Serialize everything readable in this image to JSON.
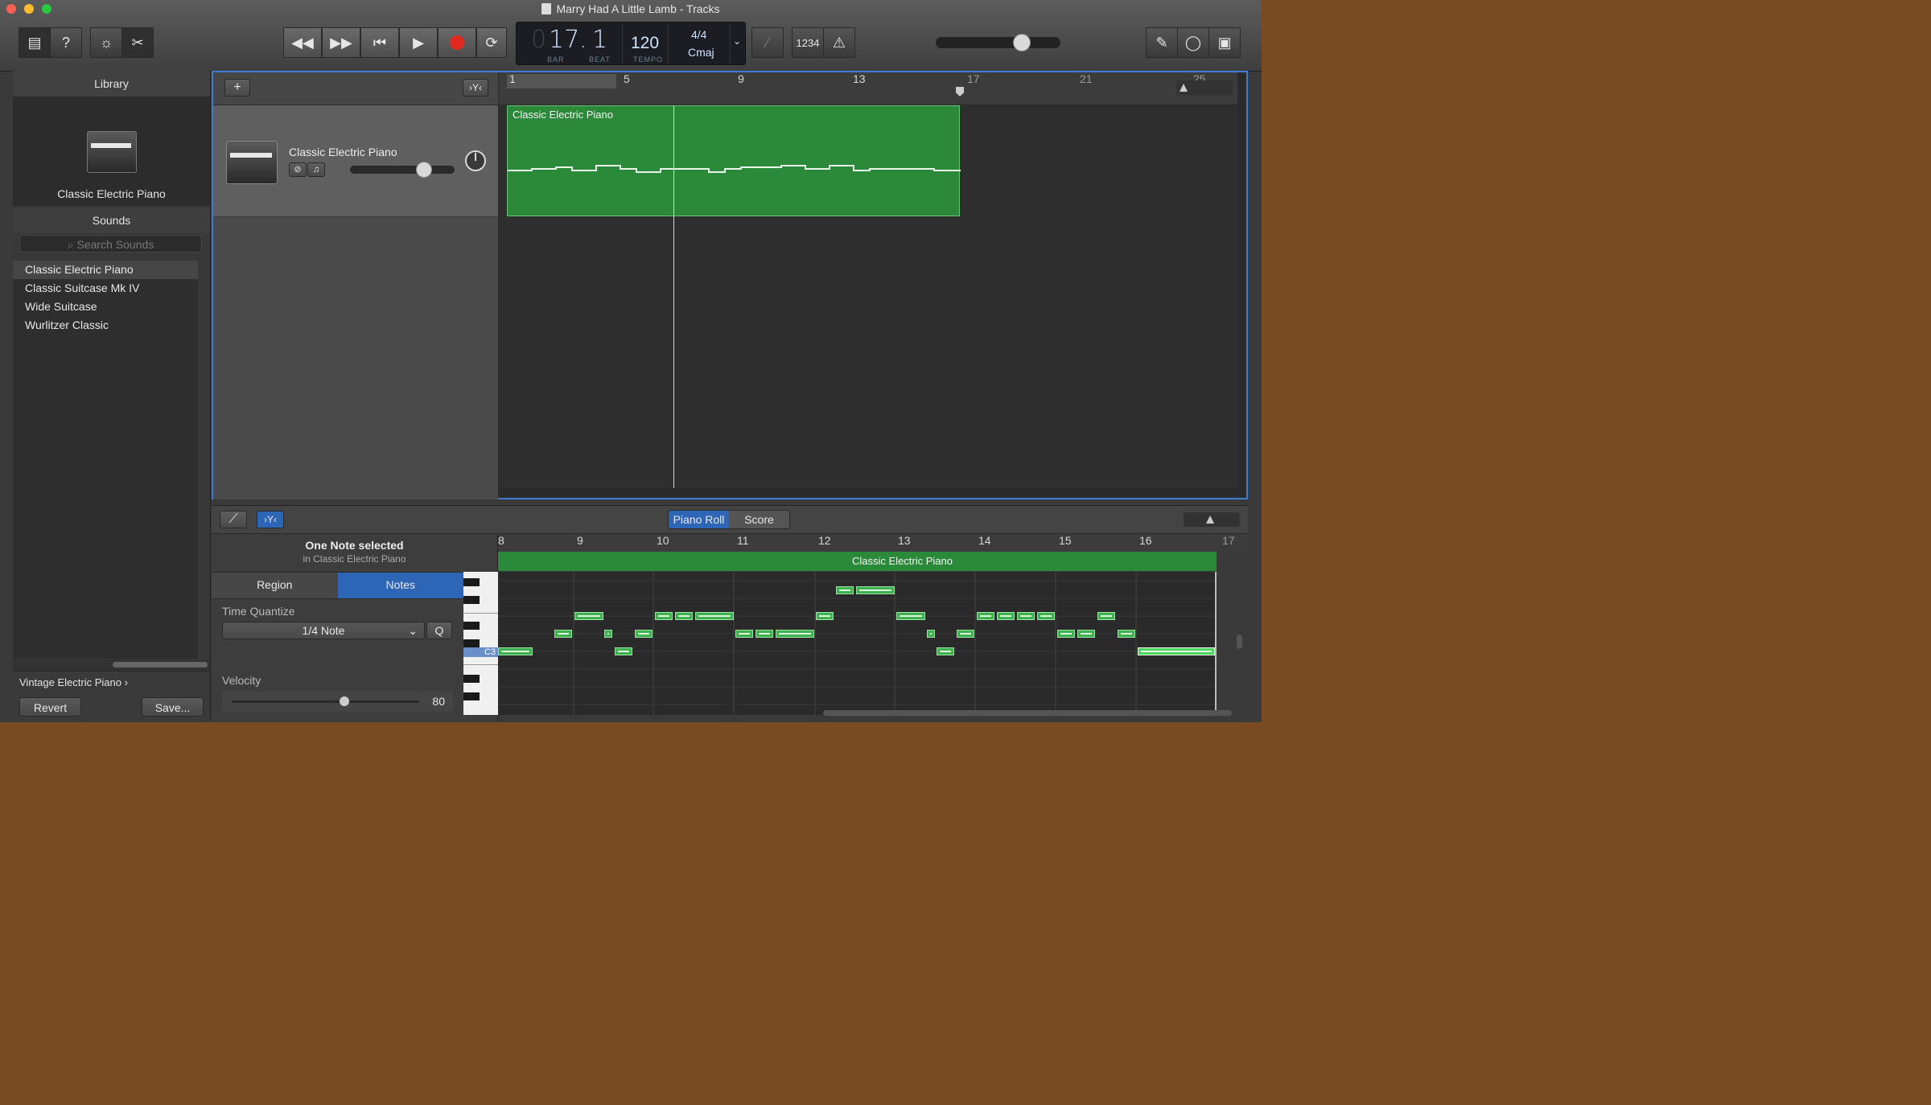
{
  "window": {
    "title": "Marry Had A Little Lamb - Tracks"
  },
  "toolbar": {
    "lcd": {
      "bar_lead": "0",
      "bar": "17",
      "beat": "1",
      "bar_label": "BAR",
      "beat_label": "BEAT",
      "tempo": "120",
      "tempo_label": "TEMPO",
      "signature": "4/4",
      "key": "Cmaj"
    },
    "count_in": "1234"
  },
  "library": {
    "header": "Library",
    "current_patch": "Classic Electric Piano",
    "sounds_header": "Sounds",
    "search_placeholder": "Search Sounds",
    "sounds": [
      "Classic Electric Piano",
      "Classic Suitcase Mk IV",
      "Wide Suitcase",
      "Wurlitzer Classic"
    ],
    "breadcrumb": "Vintage Electric Piano",
    "revert": "Revert",
    "save": "Save..."
  },
  "tracks": {
    "track_name": "Classic Electric Piano",
    "region_name": "Classic Electric Piano",
    "ruler": [
      "1",
      "5",
      "9",
      "13",
      "17",
      "21",
      "25"
    ]
  },
  "editor": {
    "tab_piano_roll": "Piano Roll",
    "tab_score": "Score",
    "selection_title": "One Note selected",
    "selection_sub": "in Classic Electric Piano",
    "tab_region": "Region",
    "tab_notes": "Notes",
    "time_quantize_label": "Time Quantize",
    "time_quantize_value": "1/4 Note",
    "quantize_button": "Q",
    "velocity_label": "Velocity",
    "velocity_value": "80",
    "velocity_fraction": 0.6,
    "key_label": "C3",
    "ruler": [
      "8",
      "9",
      "10",
      "11",
      "12",
      "13",
      "14",
      "15",
      "16",
      "17"
    ],
    "region_name": "Classic Electric Piano"
  },
  "colors": {
    "accent": "#2d65b7",
    "region": "#2a8a3a",
    "record": "#e02a1f"
  }
}
